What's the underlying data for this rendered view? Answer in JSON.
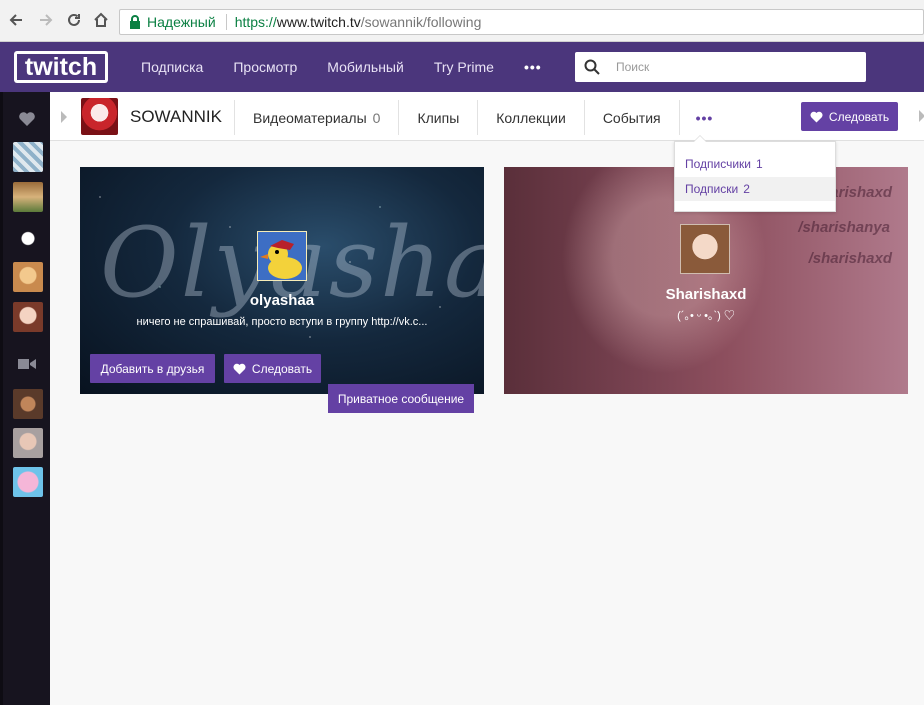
{
  "browser": {
    "secure_label": "Надежный",
    "url_scheme": "https://",
    "url_host": "www.twitch.tv",
    "url_path": "/sowannik/following"
  },
  "topbar": {
    "logo_text": "twitch",
    "nav": [
      "Подписка",
      "Просмотр",
      "Мобильный",
      "Try Prime"
    ],
    "more": "•••",
    "search_placeholder": "Поиск"
  },
  "channel": {
    "name": "SOWANNIK",
    "tabs": [
      {
        "label": "Видеоматериалы",
        "count": "0"
      },
      {
        "label": "Клипы"
      },
      {
        "label": "Коллекции"
      },
      {
        "label": "События"
      }
    ],
    "more": "•••",
    "follow_label": "Следовать"
  },
  "dropdown": {
    "items": [
      {
        "label": "Подписчики",
        "count": "1"
      },
      {
        "label": "Подписки",
        "count": "2"
      }
    ]
  },
  "cards": [
    {
      "name": "olyashaa",
      "bio": "ничего не спрашивай, просто вступи в группу http://vk.c...",
      "watermark": "Olyasha",
      "add_friend_label": "Добавить в друзья",
      "follow_label": "Следовать",
      "message_label": "Приватное сообщение"
    },
    {
      "name": "Sharishaxd",
      "bio": "(´｡• ᵕ •｡`) ♡",
      "watermarks": [
        "sharishaxd",
        "/sharishanya",
        "/sharishaxd"
      ]
    }
  ],
  "colors": {
    "brand": "#6441a4",
    "topbar": "#4b367c",
    "sidebar": "#17141f"
  }
}
